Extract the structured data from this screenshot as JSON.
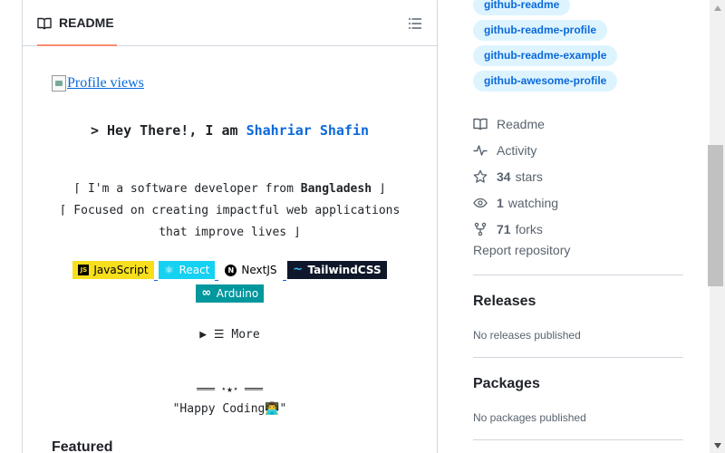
{
  "readme": {
    "tab_label": "README",
    "profile_views_alt": "Profile views",
    "greeting_prefix": "> Hey There!, I am ",
    "greeting_name": "Shahriar Shafin",
    "about_line1_prefix": "⌈ I'm a software developer from ",
    "about_line1_bold": "Bangladesh",
    "about_line1_suffix": " ⌋",
    "about_line2": "⌈ Focused on creating impactful web applications",
    "about_line3": "that improve lives ⌋",
    "badges": [
      {
        "label": "JavaScript",
        "icon": "JS",
        "bg": "#f7df1e",
        "fg": "#000000"
      },
      {
        "label": "React",
        "icon": "⚛",
        "bg": "#20232a",
        "fg": "#61dafb"
      },
      {
        "label": "NextJS",
        "icon": "N",
        "bg": "#ffffff",
        "fg": "#000000"
      },
      {
        "label": "TailwindCSS",
        "icon": "~",
        "bg": "#0f172a",
        "fg": "#ffffff"
      },
      {
        "label": "Arduino",
        "icon": "∞",
        "bg": "#00979d",
        "fg": "#ffffff"
      }
    ],
    "more_label": "▶ ☰ More",
    "stars_line": "═══ ⋆★⋆ ═══",
    "happy_coding": "\"Happy Coding👨‍💻\"",
    "featured": "Featured"
  },
  "sidebar": {
    "topics": [
      "github-readme",
      "github-readme-profile",
      "github-readme-example",
      "github-awesome-profile"
    ],
    "readme_label": "Readme",
    "activity_label": "Activity",
    "stars_count": "34",
    "stars_label": "stars",
    "watching_count": "1",
    "watching_label": "watching",
    "forks_count": "71",
    "forks_label": "forks",
    "report": "Report repository",
    "releases_title": "Releases",
    "releases_text": "No releases published",
    "packages_title": "Packages",
    "packages_text": "No packages published"
  },
  "colors": {
    "accent": "#0969da",
    "tab_underline": "#fd8c73",
    "topic_bg": "#ddf4ff"
  }
}
